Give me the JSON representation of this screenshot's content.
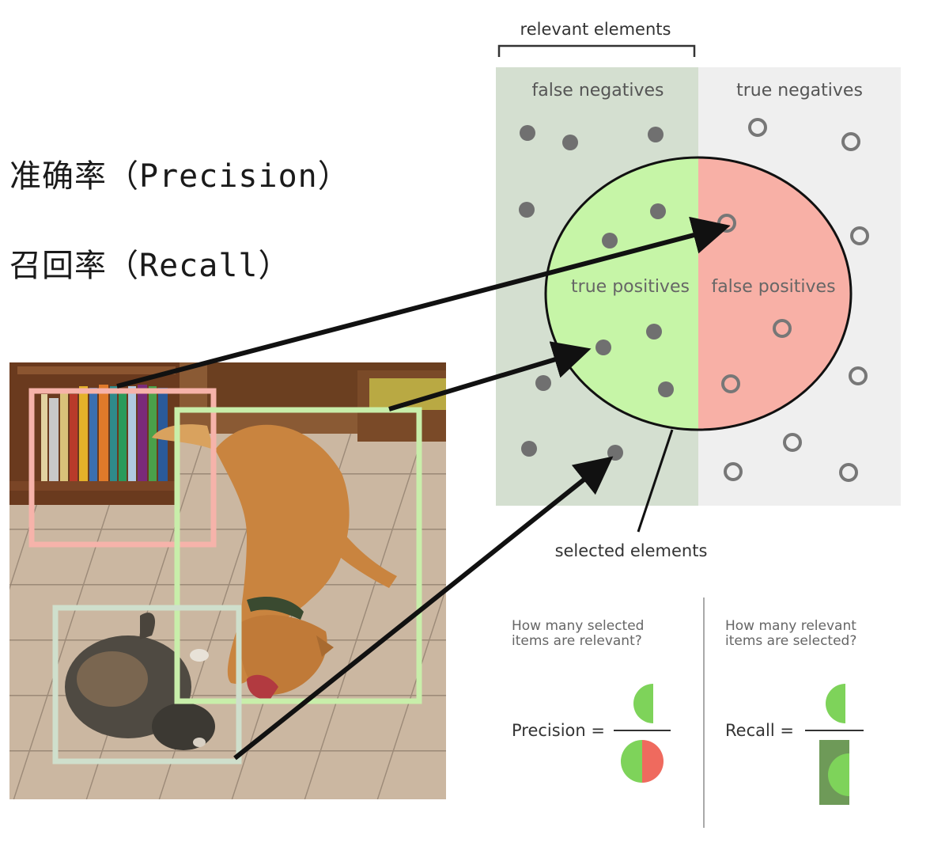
{
  "headings": {
    "precision": "准确率（Precision）",
    "recall": "召回率（Recall）"
  },
  "diagram": {
    "relevant_label": "relevant elements",
    "false_negatives": "false negatives",
    "true_negatives": "true negatives",
    "true_positives": "true positives",
    "false_positives": "false positives",
    "selected_label": "selected elements",
    "precision_question_1": "How many selected",
    "precision_question_2": "items are relevant?",
    "recall_question_1": "How many relevant",
    "recall_question_2": "items are selected?",
    "precision_formula": "Precision =",
    "recall_formula": "Recall ="
  },
  "photo": {
    "boxes": [
      {
        "name": "false-positive-box",
        "color": "#f6b3aa"
      },
      {
        "name": "true-positive-dog-box",
        "color": "#c8eeaa"
      },
      {
        "name": "true-positive-cat-box",
        "color": "#cfdfcc"
      }
    ]
  },
  "colors": {
    "relevant_bg": "#d4dfd0",
    "irrelevant_bg": "#efefef",
    "true_positive": "#c6f5a7",
    "false_positive": "#f8b0a6",
    "dot": "#707070",
    "recall_bar": "#6e9a58"
  }
}
